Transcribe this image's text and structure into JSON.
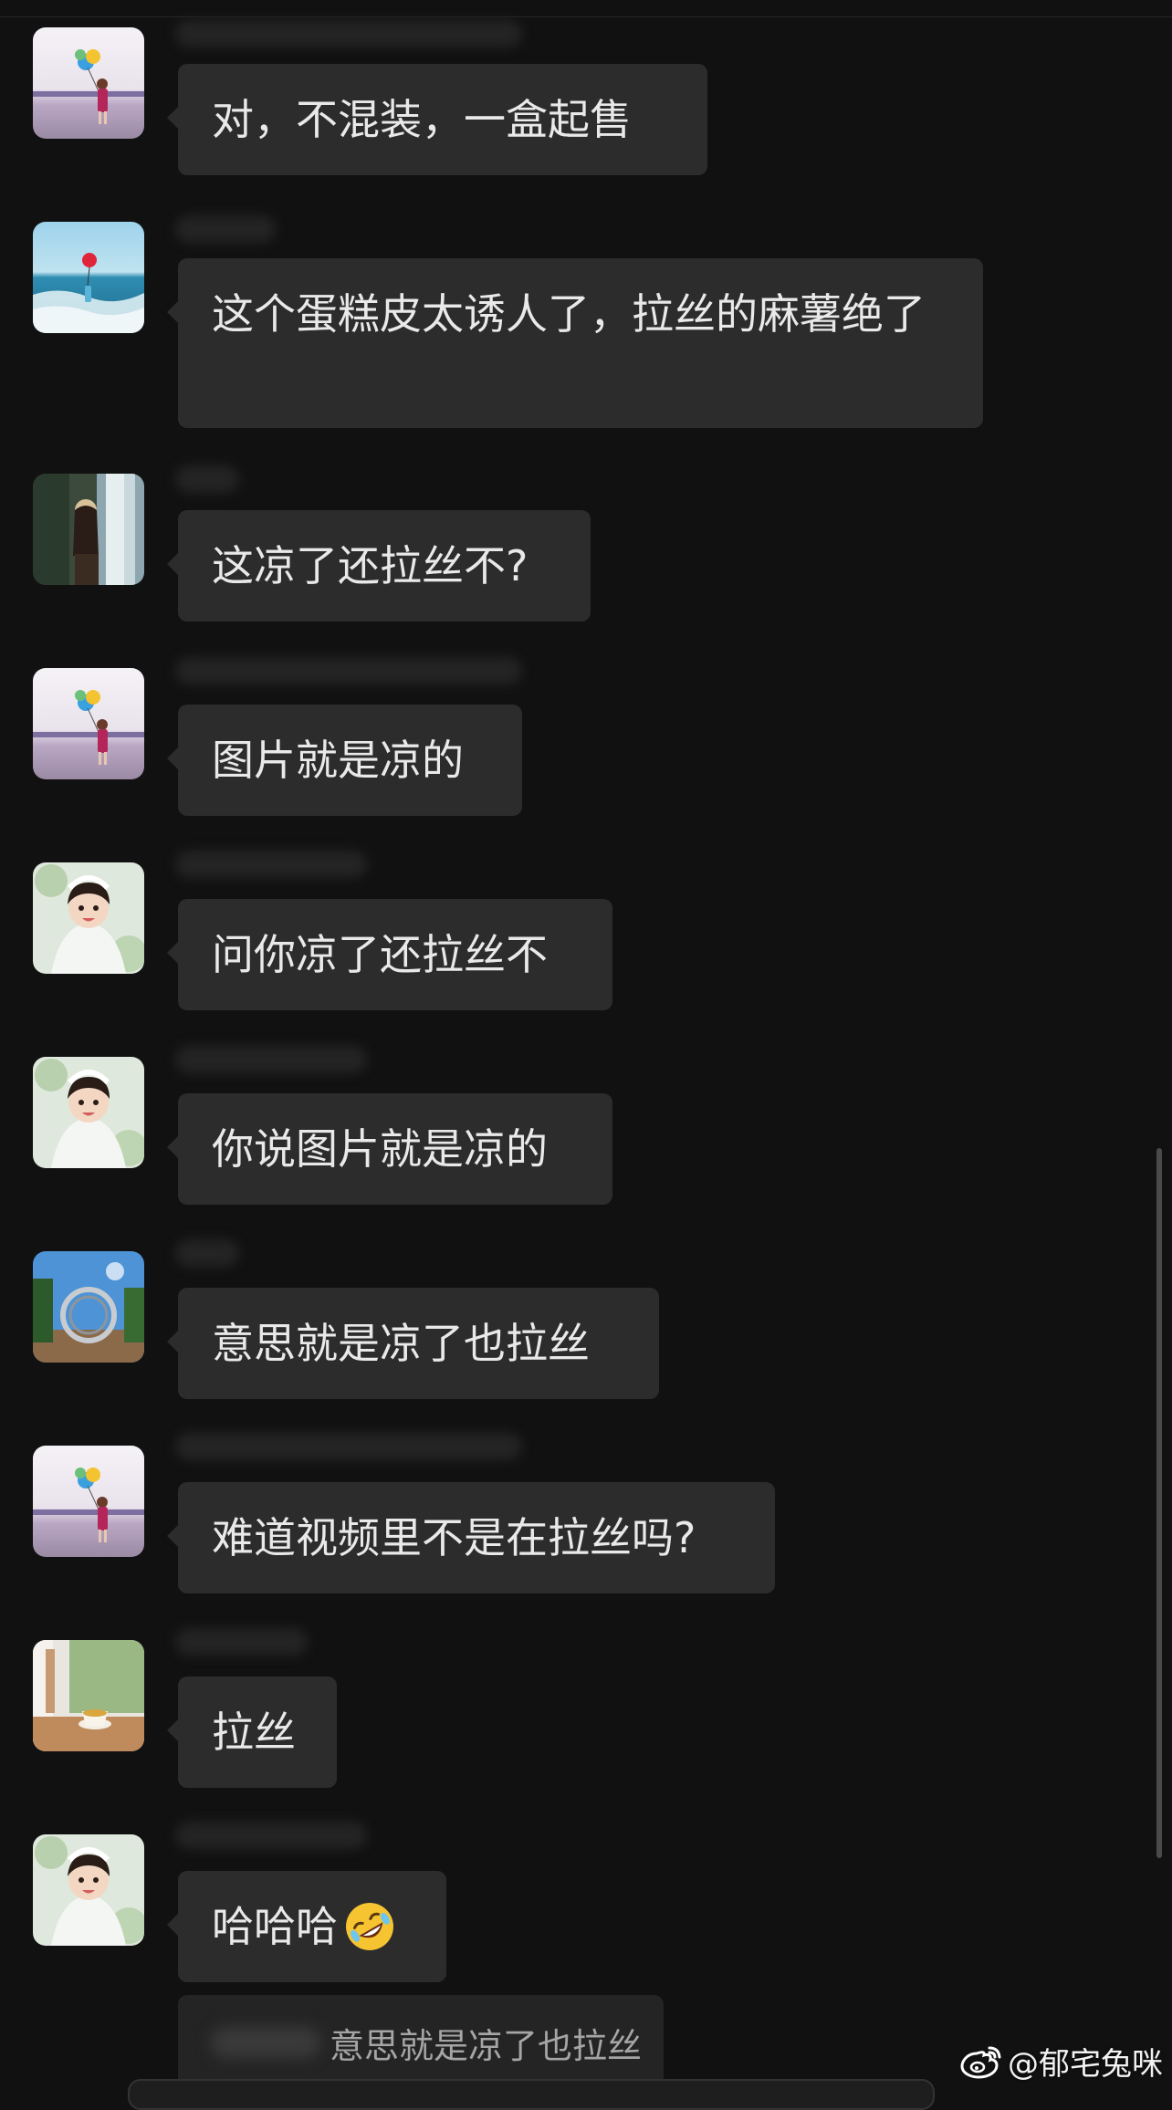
{
  "messages": [
    {
      "avatar": "balloon-girl-beach",
      "text": "对，不混装，一盒起售"
    },
    {
      "avatar": "sea-red-balloon",
      "text": "这个蛋糕皮太诱人了，拉丝的麻薯绝了"
    },
    {
      "avatar": "waterfall-girl",
      "text": "这凉了还拉丝不?"
    },
    {
      "avatar": "balloon-girl-beach",
      "text": "图片就是凉的"
    },
    {
      "avatar": "anime-bride",
      "text": "问你凉了还拉丝不"
    },
    {
      "avatar": "anime-bride",
      "text": "你说图片就是凉的"
    },
    {
      "avatar": "park-arch",
      "text": "意思就是凉了也拉丝"
    },
    {
      "avatar": "balloon-girl-beach",
      "text": "难道视频里不是在拉丝吗?"
    },
    {
      "avatar": "tea-cup-window",
      "text": "拉丝"
    },
    {
      "avatar": "anime-bride",
      "text": "哈哈哈",
      "emoji": "rolling-laughing-emoji"
    }
  ],
  "quote": {
    "text": "意思就是凉了也拉丝"
  },
  "watermark": {
    "text": "@郁宅兔咪",
    "icon": "weibo-icon"
  },
  "colors": {
    "background": "#111111",
    "bubble": "#2c2c2c",
    "text": "#e9e9e9"
  }
}
